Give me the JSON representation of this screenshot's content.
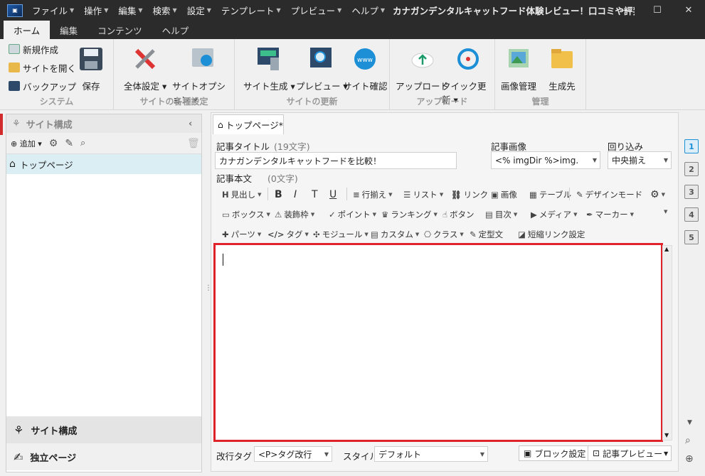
{
  "titlebar": {
    "menus": [
      "ファイル",
      "操作",
      "編集",
      "検索",
      "設定",
      "テンプレート",
      "プレビュー",
      "ヘルプ"
    ],
    "title": "カナガンデンタルキャットフード体験レビュー！口コミや評判が本当...",
    "min": "—",
    "max": "☐",
    "close": "✕"
  },
  "ribbon_tabs": [
    "ホーム",
    "編集",
    "コンテンツ",
    "ヘルプ"
  ],
  "ribbon": {
    "system": {
      "new": "新規作成",
      "open": "サイトを開く",
      "backup": "バックアップ",
      "save": "保存",
      "label": "システム"
    },
    "settings": {
      "all": "全体設定",
      "option": "サイトオプション",
      "label": "サイトの各種設定"
    },
    "update": {
      "generate": "サイト生成",
      "preview": "プレビュー",
      "check": "サイト確認",
      "label": "サイトの更新"
    },
    "upload": {
      "upload": "アップロード",
      "quick": "クイック更新",
      "label": "アップロード"
    },
    "manage": {
      "images": "画像管理",
      "dest": "生成先",
      "label": "管理"
    }
  },
  "left": {
    "header": "サイト構成",
    "add": "追加",
    "tree_item": "トップページ",
    "bottom1": "サイト構成",
    "bottom2": "独立ページ"
  },
  "editor": {
    "tab": "トップページ*",
    "title_label": "記事タイトル",
    "title_count": "(19文字)",
    "title_value": "カナガンデンタルキャットフードを比較！",
    "image_label": "記事画像",
    "image_value": "<% imgDir %>img.",
    "wrap_label": "回り込み",
    "wrap_value": "中央揃え",
    "body_label": "記事本文",
    "body_count": "(0文字)",
    "toolbar1": [
      "見出し",
      "B",
      "I",
      "T",
      "U",
      "行揃え",
      "リスト",
      "リンク",
      "画像",
      "テーブル",
      "デザインモード"
    ],
    "toolbar2": [
      "ボックス",
      "装飾枠",
      "ポイント",
      "ランキング",
      "ボタン",
      "目次",
      "メディア",
      "マーカー"
    ],
    "toolbar3": [
      "パーツ",
      "タグ",
      "モジュール",
      "カスタム",
      "クラス",
      "定型文",
      "短縮リンク設定"
    ],
    "linebreak_label": "改行タグ",
    "linebreak_value": "<P>タグ改行",
    "style_label": "スタイル",
    "style_value": "デフォルト",
    "block_btn": "ブロック設定",
    "preview_btn": "記事プレビュー"
  },
  "pages": [
    "1",
    "2",
    "3",
    "4",
    "5"
  ],
  "colors": {
    "highlight": "#e0232b",
    "titlebar": "#2b2b2b"
  }
}
